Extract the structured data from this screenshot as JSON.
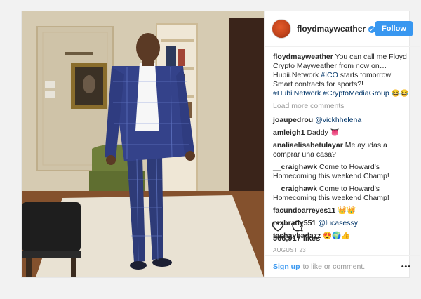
{
  "post": {
    "username": "floydmayweather",
    "follow_label": "Follow",
    "caption": {
      "user": "floydmayweather",
      "text1": "You can call me Floyd Crypto Mayweather from now on…Hubii.Network ",
      "tag1": "#ICO",
      "text2": " starts tomorrow! Smart contracts for sports?! ",
      "tag2": "#HubiiNetwork",
      "text3": " ",
      "tag3": "#CryptoMediaGroup",
      "emoji": "😂😂"
    },
    "load_more": "Load more comments",
    "comments": [
      {
        "user": "joaupedrou",
        "text": "@vickhhelena",
        "is_tag": true
      },
      {
        "user": "amleigh1",
        "text": "Daddy 👅",
        "is_tag": false
      },
      {
        "user": "analiaelisabetulayar",
        "text": "Me ayudas a comprar una casa?",
        "is_tag": false
      },
      {
        "user": "__craighawk",
        "text": "Come to Howard's Homecoming this weekend Champ!",
        "is_tag": false
      },
      {
        "user": "__craighawk",
        "text": "Come to Howard's Homecoming this weekend Champ!",
        "is_tag": false
      },
      {
        "user": "facundoarreyes11",
        "text": "👑👑",
        "is_tag": false
      },
      {
        "user": "mxbrady551",
        "text": "@lucasessy",
        "is_tag": true
      },
      {
        "user": "tashaybadazz",
        "text": "😍🌍👍",
        "is_tag": false
      }
    ],
    "likes": "566,917 likes",
    "date": "AUGUST 23",
    "footer": {
      "signup": "Sign up",
      "rest": "to like or comment.",
      "more": "•••"
    },
    "icons": {
      "like": "heart-icon",
      "comment": "comment-bubble-icon",
      "options": "more-options-icon"
    },
    "colors": {
      "accent": "#3897f0",
      "hashtag": "#003569",
      "muted": "#999999"
    }
  }
}
